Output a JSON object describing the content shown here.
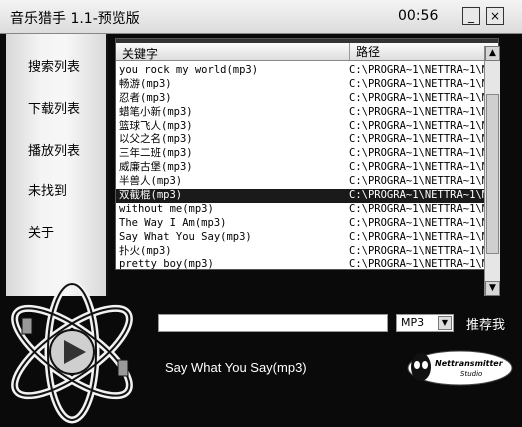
{
  "window": {
    "title": "音乐猎手 1.1-预览版",
    "clock": "00:56",
    "minimize_label": "_",
    "close_label": "×"
  },
  "sidebar": {
    "items": [
      {
        "label": "搜索列表"
      },
      {
        "label": "下载列表"
      },
      {
        "label": "播放列表"
      },
      {
        "label": "未找到"
      },
      {
        "label": "关于"
      }
    ]
  },
  "list": {
    "columns": [
      "关键字",
      "路径"
    ],
    "rows": [
      {
        "keyword": "you rock my world(mp3)",
        "path": "C:\\PROGRA~1\\NETTRA~1\\M"
      },
      {
        "keyword": "畅游(mp3)",
        "path": "C:\\PROGRA~1\\NETTRA~1\\M"
      },
      {
        "keyword": "忍者(mp3)",
        "path": "C:\\PROGRA~1\\NETTRA~1\\M"
      },
      {
        "keyword": "蜡笔小新(mp3)",
        "path": "C:\\PROGRA~1\\NETTRA~1\\M"
      },
      {
        "keyword": "篮球飞人(mp3)",
        "path": "C:\\PROGRA~1\\NETTRA~1\\M"
      },
      {
        "keyword": "以父之名(mp3)",
        "path": "C:\\PROGRA~1\\NETTRA~1\\M"
      },
      {
        "keyword": "三年二班(mp3)",
        "path": "C:\\PROGRA~1\\NETTRA~1\\M"
      },
      {
        "keyword": "威廉古堡(mp3)",
        "path": "C:\\PROGRA~1\\NETTRA~1\\M"
      },
      {
        "keyword": "半兽人(mp3)",
        "path": "C:\\PROGRA~1\\NETTRA~1\\M"
      },
      {
        "keyword": "双截棍(mp3)",
        "path": "C:\\PROGRA~1\\NETTRA~1\\M",
        "selected": true
      },
      {
        "keyword": "without me(mp3)",
        "path": "C:\\PROGRA~1\\NETTRA~1\\M"
      },
      {
        "keyword": "The Way I Am(mp3)",
        "path": "C:\\PROGRA~1\\NETTRA~1\\M"
      },
      {
        "keyword": "Say What You Say(mp3)",
        "path": "C:\\PROGRA~1\\NETTRA~1\\M"
      },
      {
        "keyword": "扑火(mp3)",
        "path": "C:\\PROGRA~1\\NETTRA~1\\M"
      },
      {
        "keyword": "pretty boy(mp3)",
        "path": "C:\\PROGRA~1\\NETTRA~1\\M"
      }
    ]
  },
  "scrollbar": {
    "up_icon": "▲",
    "down_icon": "▼"
  },
  "search": {
    "value": "",
    "format_selected": "MP3",
    "format_arrow": "▼",
    "recommend_label": "推荐我"
  },
  "player": {
    "now_playing": "Say What You Say(mp3)"
  },
  "branding": {
    "studio_name_line1": "Nettransmitter",
    "studio_name_line2": "Studio"
  }
}
